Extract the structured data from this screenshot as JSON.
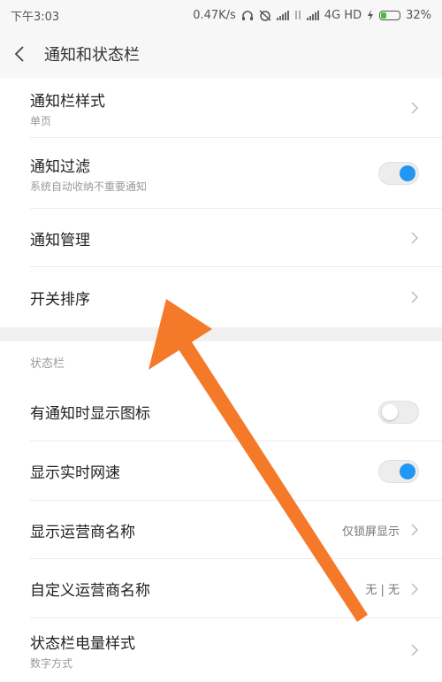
{
  "status_bar": {
    "time": "下午3:03",
    "speed": "0.47K/s",
    "network": "4G HD",
    "battery": "32%",
    "battery_level": 0.32
  },
  "header": {
    "title": "通知和状态栏",
    "back_icon": "back-arrow-icon"
  },
  "notification_section": {
    "rows": [
      {
        "label": "通知栏样式",
        "sub": "单页",
        "control": "chevron"
      },
      {
        "label": "通知过滤",
        "sub": "系统自动收纳不重要通知",
        "control": "toggle",
        "on": true
      },
      {
        "label": "通知管理",
        "control": "chevron"
      },
      {
        "label": "开关排序",
        "control": "chevron"
      }
    ]
  },
  "status_section": {
    "title": "状态栏",
    "rows": [
      {
        "label": "有通知时显示图标",
        "control": "toggle",
        "on": false
      },
      {
        "label": "显示实时网速",
        "control": "toggle",
        "on": true
      },
      {
        "label": "显示运营商名称",
        "value": "仅锁屏显示",
        "control": "chevron"
      },
      {
        "label": "自定义运营商名称",
        "value": "无 | 无",
        "control": "chevron"
      },
      {
        "label": "状态栏电量样式",
        "sub": "数字方式",
        "control": "chevron"
      }
    ]
  },
  "colors": {
    "accent": "#2196f3",
    "annotation_arrow": "#f47a2a"
  }
}
